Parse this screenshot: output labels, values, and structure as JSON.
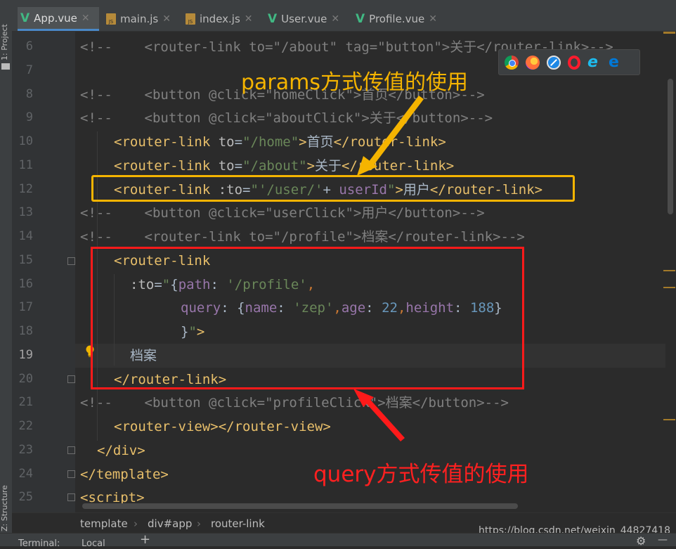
{
  "sidebar": {
    "project_label": "1: Project",
    "structure_label": "Z: Structure"
  },
  "tabs": [
    {
      "label": "App.vue",
      "type": "vue",
      "active": true
    },
    {
      "label": "main.js",
      "type": "js",
      "active": false
    },
    {
      "label": "index.js",
      "type": "js",
      "active": false
    },
    {
      "label": "User.vue",
      "type": "vue",
      "active": false
    },
    {
      "label": "Profile.vue",
      "type": "vue",
      "active": false
    }
  ],
  "line_numbers": [
    "6",
    "7",
    "8",
    "9",
    "10",
    "11",
    "12",
    "13",
    "14",
    "15",
    "16",
    "17",
    "18",
    "19",
    "20",
    "21",
    "22",
    "23",
    "24",
    "25"
  ],
  "current_line": "19",
  "code": {
    "l6": {
      "c1": "<!--    <router-link to=\"/about\" tag=\"button\">关于</router-link>-->"
    },
    "l8": {
      "c1": "<!--    <button @click=\"homeClick\">首页</button>-->"
    },
    "l9": {
      "c1": "<!--    <button @click=\"aboutClick\">关于</button>-->"
    },
    "l10": {
      "t1": "<router-link ",
      "a1": "to",
      "p1": "=",
      "s1": "\"/home\"",
      "t2": ">",
      "x1": "首页",
      "t3": "</router-link>"
    },
    "l11": {
      "t1": "<router-link ",
      "a1": "to",
      "p1": "=",
      "s1": "\"/about\"",
      "t2": ">",
      "x1": "关于",
      "t3": "</router-link>"
    },
    "l12": {
      "t1": "<router-link ",
      "a1": ":to",
      "p1": "=",
      "s1": "\"",
      "s2": "'/user/'",
      "x1": "+ ",
      "k1": "userId",
      "s3": "\"",
      "t2": ">",
      "x2": "用户",
      "t3": "</router-link>"
    },
    "l13": {
      "c1": "<!--    <button @click=\"userClick\">用户</button>-->"
    },
    "l14": {
      "c1": "<!--    <router-link to=\"/profile\">档案</router-link>-->"
    },
    "l15": {
      "t1": "<router-link"
    },
    "l16": {
      "a1": ":to",
      "p1": "=",
      "s1": "\"",
      "x1": "{",
      "k1": "path",
      "x2": ": ",
      "s2": "'/profile'",
      "p2": ","
    },
    "l17": {
      "k1": "query",
      "x1": ": {",
      "k2": "name",
      "x2": ": ",
      "s1": "'zep'",
      "p1": ",",
      "k3": "age",
      "x3": ": ",
      "n1": "22",
      "p2": ",",
      "k4": "height",
      "x4": ": ",
      "n2": "188",
      "x5": "}"
    },
    "l18": {
      "x1": "}",
      "s1": "\"",
      "t1": ">"
    },
    "l19": {
      "x1": "档案"
    },
    "l20": {
      "t1": "</router-link>"
    },
    "l21": {
      "c1": "<!--    <button @click=\"profileClick\">档案</button>-->"
    },
    "l22": {
      "t1": "<router-view></router-view>"
    },
    "l23": {
      "t1": "</div>"
    },
    "l24": {
      "t1": "</template>"
    },
    "l25": {
      "t1": "<script>"
    }
  },
  "annotations": {
    "params": "params方式传值的使用",
    "query": "query方式传值的使用",
    "yellow_color": "#f5b400",
    "red_color": "#ff1a1a"
  },
  "browser_icons": [
    "chrome-icon",
    "firefox-icon",
    "safari-icon",
    "opera-icon",
    "ie-icon",
    "edge-icon"
  ],
  "breadcrumb": [
    "template",
    "div#app",
    "router-link"
  ],
  "watermark": "https://blog.csdn.net/weixin_44827418",
  "statusbar": {
    "terminal": "Terminal:",
    "local": "Local"
  }
}
